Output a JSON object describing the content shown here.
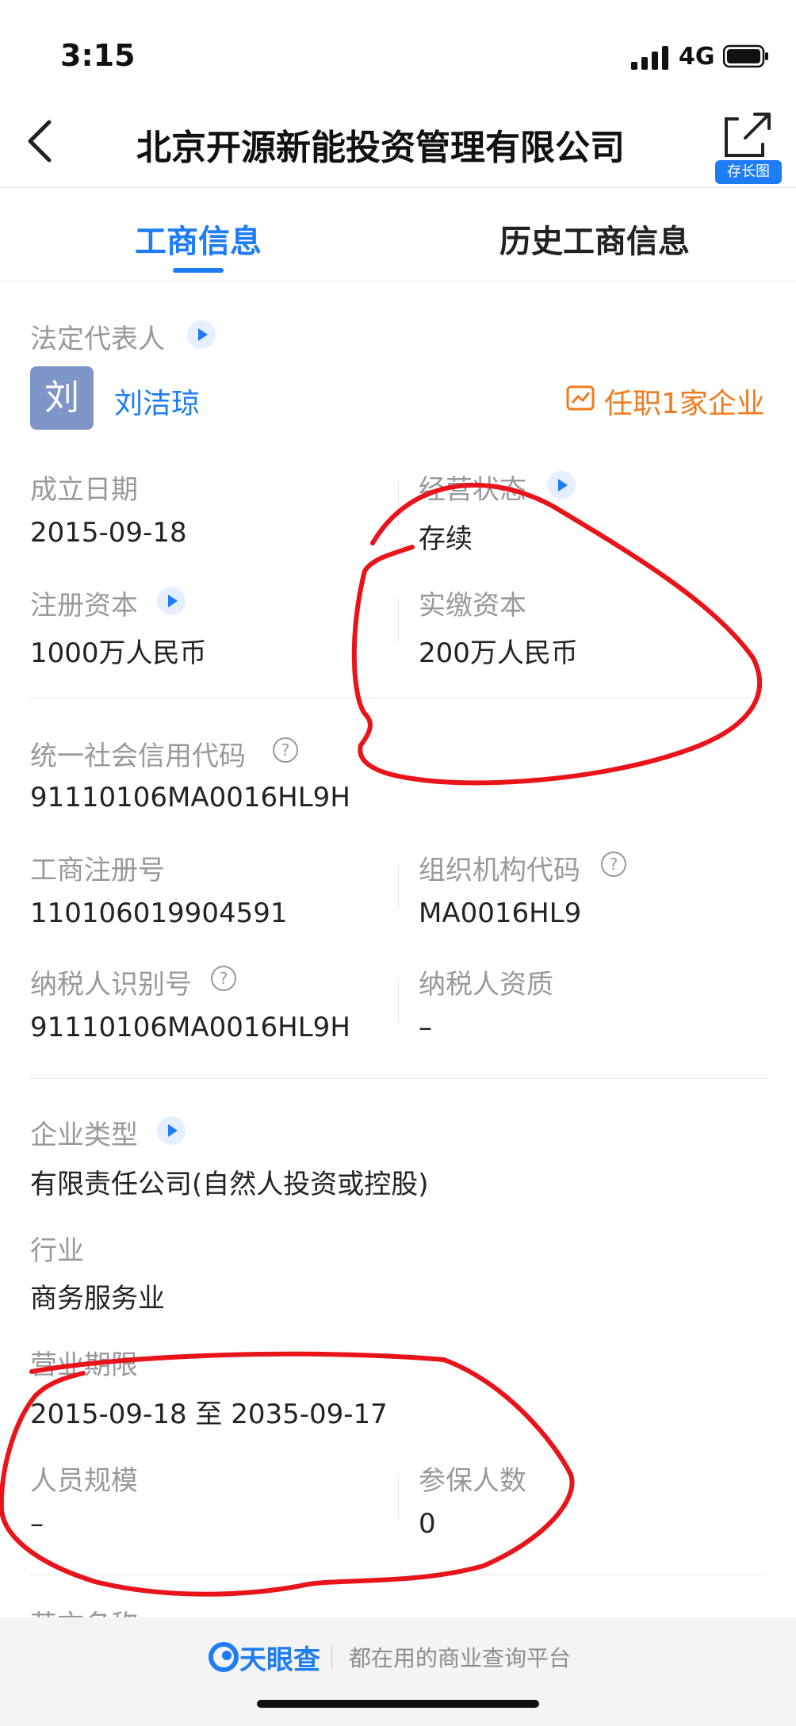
{
  "status": {
    "time": "3:15",
    "network": "4G"
  },
  "nav": {
    "title": "北京开源新能投资管理有限公司",
    "share_badge": "存长图"
  },
  "tabs": [
    {
      "label": "工商信息"
    },
    {
      "label": "历史工商信息"
    }
  ],
  "legal_rep": {
    "label": "法定代表人",
    "avatar_char": "刘",
    "name": "刘洁琼",
    "positions_text": "任职1家企业"
  },
  "info": {
    "founded": {
      "label": "成立日期",
      "value": "2015-09-18"
    },
    "status": {
      "label": "经营状态",
      "value": "存续"
    },
    "registered_capital": {
      "label": "注册资本",
      "value": "1000万人民币"
    },
    "paid_capital": {
      "label": "实缴资本",
      "value": "200万人民币"
    },
    "credit_code": {
      "label": "统一社会信用代码",
      "value": "91110106MA0016HL9H"
    },
    "reg_number": {
      "label": "工商注册号",
      "value": "110106019904591"
    },
    "org_code": {
      "label": "组织机构代码",
      "value": "MA0016HL9"
    },
    "taxpayer_id": {
      "label": "纳税人识别号",
      "value": "91110106MA0016HL9H"
    },
    "taxpayer_qual": {
      "label": "纳税人资质",
      "value": "–"
    },
    "company_type": {
      "label": "企业类型",
      "value": "有限责任公司(自然人投资或控股)"
    },
    "industry": {
      "label": "行业",
      "value": "商务服务业"
    },
    "term": {
      "label": "营业期限",
      "value": "2015-09-18 至 2035-09-17"
    },
    "staff_size": {
      "label": "人员规模",
      "value": "–"
    },
    "insured": {
      "label": "参保人数",
      "value": "0"
    },
    "english_name": {
      "label": "英文名称"
    }
  },
  "footer": {
    "brand": "天眼查",
    "slogan": "都在用的商业查询平台"
  },
  "colors": {
    "accent": "#1e7cf5",
    "orange": "#f07b1f",
    "annotation": "#e8141a"
  }
}
